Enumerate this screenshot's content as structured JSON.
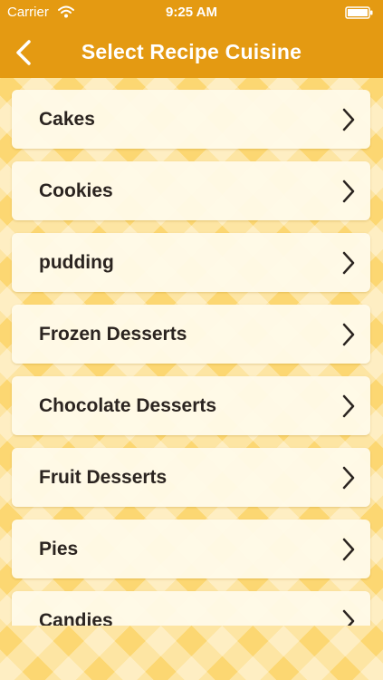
{
  "status_bar": {
    "carrier": "Carrier",
    "time": "9:25 AM",
    "wifi_icon": "wifi-icon",
    "battery_icon": "battery-icon"
  },
  "nav": {
    "title": "Select Recipe Cuisine",
    "back_icon": "chevron-left-icon"
  },
  "cuisines": [
    "Cakes",
    "Cookies",
    "pudding",
    "Frozen Desserts",
    "Chocolate Desserts",
    "Fruit Desserts",
    "Pies",
    "Candies"
  ],
  "colors": {
    "bar": "#e49a12",
    "background": "#fcd772",
    "row": "#fffae8",
    "text": "#2b2420"
  }
}
